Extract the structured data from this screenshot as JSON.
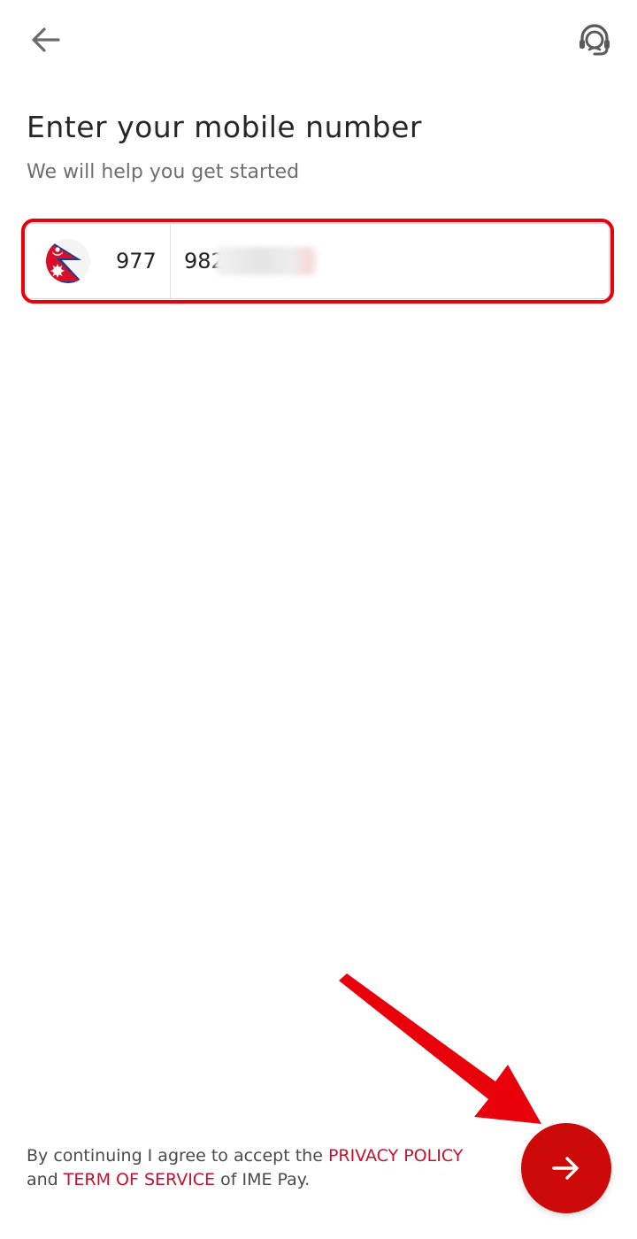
{
  "header": {
    "back_icon": "arrow-left-icon",
    "support_icon": "headset-support-icon"
  },
  "content": {
    "title": "Enter your mobile number",
    "subtitle": "We will help you get started"
  },
  "phone": {
    "country_flag": "nepal-flag-icon",
    "dial_code": "977",
    "number_value": "982"
  },
  "footer": {
    "terms_prefix": "By continuing I agree to accept the ",
    "privacy_policy": "PRIVACY POLICY",
    "terms_and": "and ",
    "term_of_service": "TERM OF SERVICE",
    "terms_suffix": " of IME Pay.",
    "next_icon": "arrow-right-icon"
  },
  "colors": {
    "brand_red": "#cc0a0a",
    "link_red": "#c8102e",
    "highlight": "#e8000b"
  }
}
